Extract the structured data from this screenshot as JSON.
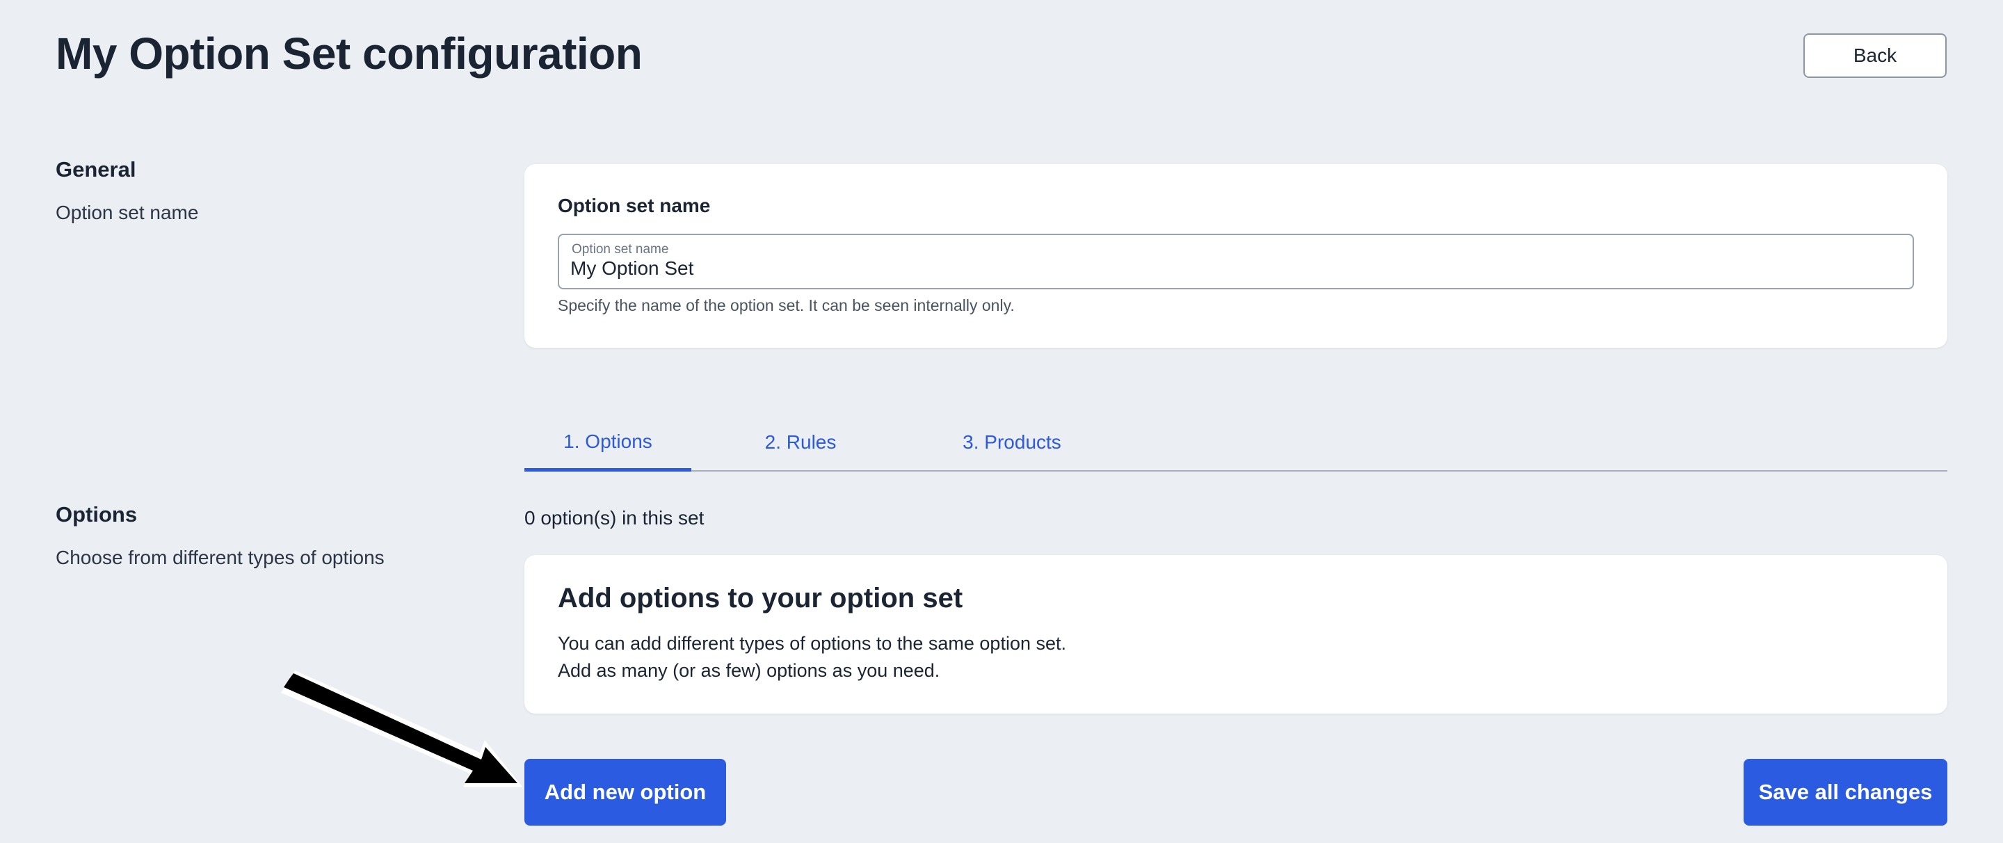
{
  "header": {
    "title": "My Option Set configuration",
    "back_label": "Back"
  },
  "general": {
    "heading": "General",
    "description": "Option set name",
    "card": {
      "field_label": "Option set name",
      "input_floating_label": "Option set name",
      "input_value": "My Option Set",
      "help_text": "Specify the name of the option set. It can be seen internally only."
    }
  },
  "tabs": [
    {
      "label": "1. Options",
      "active": true
    },
    {
      "label": "2. Rules",
      "active": false
    },
    {
      "label": "3. Products",
      "active": false
    }
  ],
  "options": {
    "heading": "Options",
    "description": "Choose from different types of options",
    "count_text": "0 option(s) in this set",
    "empty_state": {
      "title": "Add options to your option set",
      "line1": "You can add different types of options to the same option set.",
      "line2": "Add as many (or as few) options as you need."
    }
  },
  "actions": {
    "add_label": "Add new option",
    "save_label": "Save all changes"
  },
  "colors": {
    "background": "#ebeef2",
    "accent": "#2b5be0",
    "text": "#1b2433"
  }
}
